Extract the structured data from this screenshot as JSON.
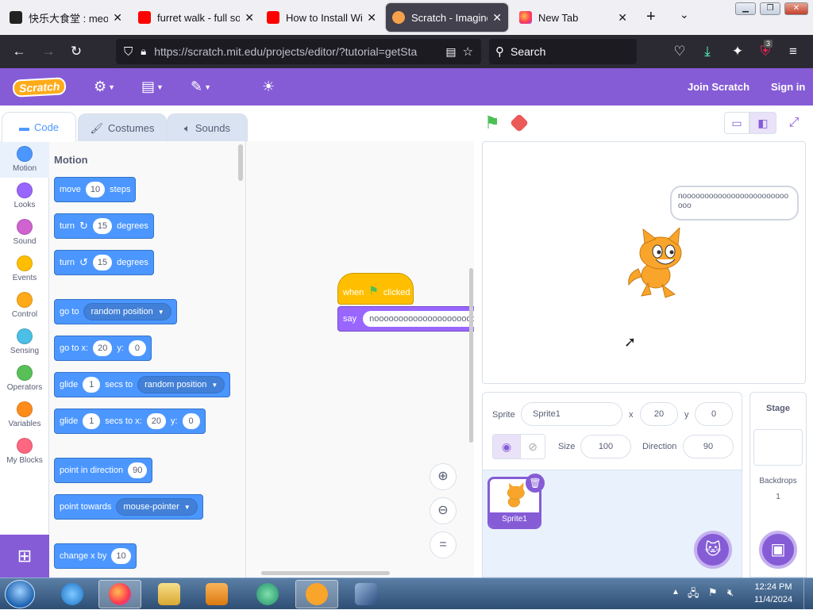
{
  "browser": {
    "tabs": [
      {
        "title": "快乐大食堂 : meow",
        "favicon": "cat-face-icon"
      },
      {
        "title": "furret walk - full so",
        "favicon": "youtube-icon"
      },
      {
        "title": "How to Install Wind",
        "favicon": "youtube-icon"
      },
      {
        "title": "Scratch - Imagine, P",
        "favicon": "scratch-icon",
        "active": true
      },
      {
        "title": "New Tab",
        "favicon": "firefox-icon"
      }
    ],
    "url": "https://scratch.mit.edu/projects/editor/?tutorial=getSta",
    "url_host": "scratch.mit.edu",
    "search_placeholder": "Search",
    "extensions_badge": "3"
  },
  "scratch": {
    "logo": "Scratch",
    "join_label": "Join Scratch",
    "signin_label": "Sign in",
    "editor_tabs": [
      "Code",
      "Costumes",
      "Sounds"
    ],
    "categories": [
      {
        "label": "Motion",
        "color": "#4c97ff"
      },
      {
        "label": "Looks",
        "color": "#9966ff"
      },
      {
        "label": "Sound",
        "color": "#cf63cf"
      },
      {
        "label": "Events",
        "color": "#ffbf00"
      },
      {
        "label": "Control",
        "color": "#ffab19"
      },
      {
        "label": "Sensing",
        "color": "#4cbfe6"
      },
      {
        "label": "Operators",
        "color": "#59c059"
      },
      {
        "label": "Variables",
        "color": "#ff8c1a"
      },
      {
        "label": "My Blocks",
        "color": "#ff6680"
      }
    ],
    "palette": {
      "heading": "Motion",
      "move": {
        "a": "move",
        "v": "10",
        "b": "steps"
      },
      "turn_right": {
        "a": "turn",
        "v": "15",
        "b": "degrees"
      },
      "turn_left": {
        "a": "turn",
        "v": "15",
        "b": "degrees"
      },
      "goto": {
        "a": "go to",
        "dd": "random position"
      },
      "gotoxy": {
        "a": "go to x:",
        "x": "20",
        "b": "y:",
        "y": "0"
      },
      "glide_to": {
        "a": "glide",
        "v": "1",
        "b": "secs to",
        "dd": "random position"
      },
      "glide_xy": {
        "a": "glide",
        "v": "1",
        "b": "secs to x:",
        "x": "20",
        "c": "y:",
        "y": "0"
      },
      "point_dir": {
        "a": "point in direction",
        "v": "90"
      },
      "point_towards": {
        "a": "point towards",
        "dd": "mouse-pointer"
      },
      "change_x": {
        "a": "change x by",
        "v": "10"
      }
    },
    "script": {
      "hat_when": "when",
      "hat_clicked": "clicked",
      "say_label": "say",
      "say_value": "nooooooooooooooooooooo"
    },
    "stage": {
      "speech": "nooooooooooooooooooooooooooo"
    },
    "sprite_info": {
      "sprite_label": "Sprite",
      "sprite_name": "Sprite1",
      "x_label": "x",
      "x": "20",
      "y_label": "y",
      "y": "0",
      "size_label": "Size",
      "size": "100",
      "direction_label": "Direction",
      "direction": "90"
    },
    "sprite_thumb_label": "Sprite1",
    "stage_pane": {
      "title": "Stage",
      "backdrops_label": "Backdrops",
      "backdrops_count": "1"
    }
  },
  "taskbar": {
    "time": "12:24 PM",
    "date": "11/4/2024"
  },
  "colors": {
    "scratch_purple": "#855cd6",
    "motion_blue": "#4c97ff",
    "events_yellow": "#ffbf00",
    "looks_purple": "#9966ff"
  }
}
